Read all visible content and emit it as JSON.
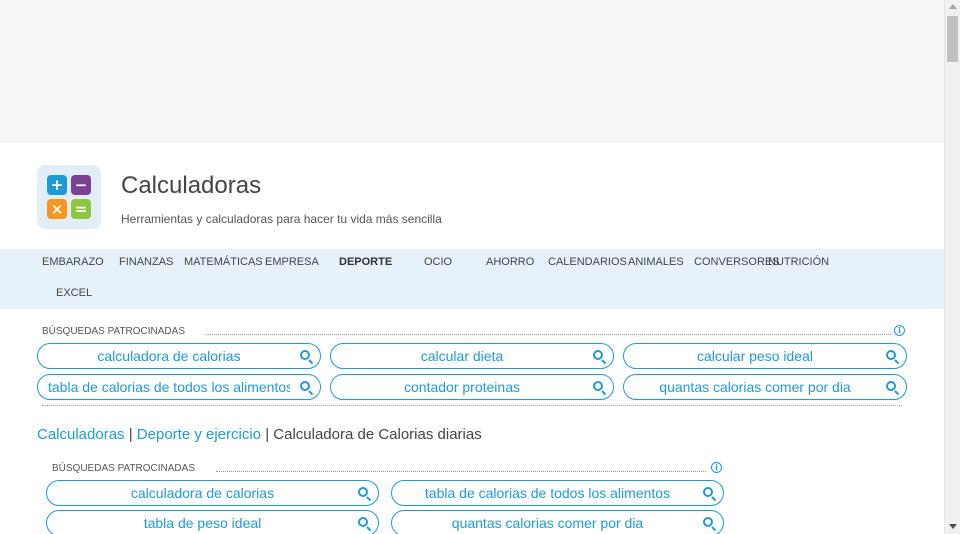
{
  "nav": {
    "items": [
      {
        "label": "EMBARAZO",
        "active": false
      },
      {
        "label": "FINANZAS",
        "active": false
      },
      {
        "label": "MATEMÁTICAS",
        "active": false
      },
      {
        "label": "EMPRESA",
        "active": false
      },
      {
        "label": "DEPORTE",
        "active": true
      },
      {
        "label": "OCIO",
        "active": false
      },
      {
        "label": "AHORRO",
        "active": false
      },
      {
        "label": "CALENDARIOS",
        "active": false
      },
      {
        "label": "ANIMALES",
        "active": false
      },
      {
        "label": "CONVERSORES",
        "active": false
      },
      {
        "label": "NUTRICIÓN",
        "active": false
      },
      {
        "label": "EXCEL",
        "active": false
      }
    ]
  },
  "header": {
    "title": "Calculadoras",
    "subtitle": "Herramientas y calculadoras para hacer tu vida más sencilla",
    "logo_tiles": [
      "+",
      "−",
      "×",
      "="
    ]
  },
  "sponsored_top": {
    "label": "BÚSQUEDAS PATROCINADAS",
    "info": "i",
    "pills": [
      "calculadora de calorias",
      "calcular dieta",
      "calcular peso ideal",
      "tabla de calorias de todos los alimentos",
      "contador proteinas",
      "quantas calorias comer por dia"
    ]
  },
  "breadcrumb": {
    "items": [
      "Calculadoras",
      "Deporte y ejercicio",
      "Calculadora de Calorias diarias"
    ],
    "separator": "|"
  },
  "sponsored_second": {
    "label": "BÚSQUEDAS PATROCINADAS",
    "info": "i",
    "pills": [
      "calculadora de calorias",
      "tabla de calorias de todos los alimentos",
      "tabla de peso ideal",
      "quantas calorias comer por dia"
    ]
  },
  "colors": {
    "accent": "#1e9bd7",
    "nav_bg": "#e7f1fa",
    "logo_blue": "#1e9bd7",
    "logo_purple": "#7b3f96",
    "logo_orange": "#f7951e",
    "logo_green": "#8dc63f"
  }
}
